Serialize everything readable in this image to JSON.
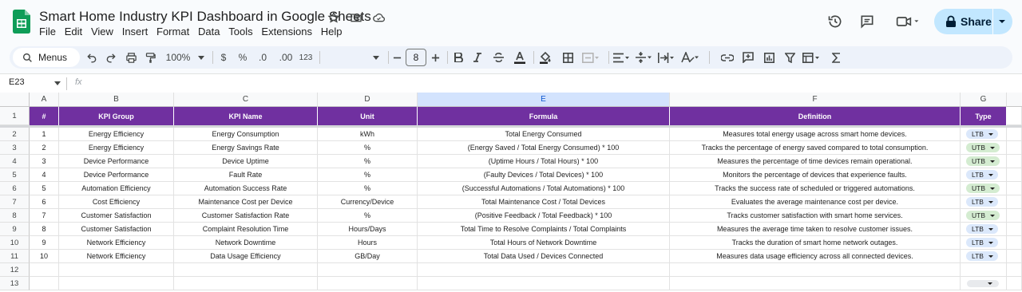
{
  "app": {
    "doc_title": "Smart Home Industry KPI Dashboard in Google Sheets",
    "menu": [
      "File",
      "Edit",
      "View",
      "Insert",
      "Format",
      "Data",
      "Tools",
      "Extensions",
      "Help"
    ],
    "share_label": "Share",
    "icons": [
      "sheets-logo",
      "star-icon",
      "move-to-folder-icon",
      "cloud-saved-icon",
      "history-icon",
      "comments-icon",
      "meet-icon"
    ]
  },
  "toolbar": {
    "search_label": "Menus",
    "zoom": "100%",
    "currency": "$",
    "percent": "%",
    "dec_decrease": ".0",
    "dec_increase": ".00",
    "number_format": "123",
    "font_size": "8"
  },
  "formula_bar": {
    "name_box": "E23",
    "fx": "fx",
    "content": ""
  },
  "sheet": {
    "columns": [
      "A",
      "B",
      "C",
      "D",
      "E",
      "F",
      "G"
    ],
    "selected_column": "E",
    "row_numbers": [
      "1",
      "2",
      "3",
      "4",
      "5",
      "6",
      "7",
      "8",
      "9",
      "10",
      "11",
      "12",
      "13"
    ],
    "header": [
      "#",
      "KPI Group",
      "KPI Name",
      "Unit",
      "Formula",
      "Definition",
      "Type"
    ],
    "header_color": "#7030a0",
    "ltb_color": "#dbe8fb",
    "utb_color": "#d4ecd1",
    "rows": [
      [
        "1",
        "Energy Efficiency",
        "Energy Consumption",
        "kWh",
        "Total Energy Consumed",
        "Measures total energy usage across smart home devices.",
        "LTB"
      ],
      [
        "2",
        "Energy Efficiency",
        "Energy Savings Rate",
        "%",
        "(Energy Saved / Total Energy Consumed) * 100",
        "Tracks the percentage of energy saved compared to total consumption.",
        "UTB"
      ],
      [
        "3",
        "Device Performance",
        "Device Uptime",
        "%",
        "(Uptime Hours / Total Hours) * 100",
        "Measures the percentage of time devices remain operational.",
        "UTB"
      ],
      [
        "4",
        "Device Performance",
        "Fault Rate",
        "%",
        "(Faulty Devices / Total Devices) * 100",
        "Monitors the percentage of devices that experience faults.",
        "LTB"
      ],
      [
        "5",
        "Automation Efficiency",
        "Automation Success Rate",
        "%",
        "(Successful Automations / Total Automations) * 100",
        "Tracks the success rate of scheduled or triggered automations.",
        "UTB"
      ],
      [
        "6",
        "Cost Efficiency",
        "Maintenance Cost per Device",
        "Currency/Device",
        "Total Maintenance Cost / Total Devices",
        "Evaluates the average maintenance cost per device.",
        "LTB"
      ],
      [
        "7",
        "Customer Satisfaction",
        "Customer Satisfaction Rate",
        "%",
        "(Positive Feedback / Total Feedback) * 100",
        "Tracks customer satisfaction with smart home services.",
        "UTB"
      ],
      [
        "8",
        "Customer Satisfaction",
        "Complaint Resolution Time",
        "Hours/Days",
        "Total Time to Resolve Complaints / Total Complaints",
        "Measures the average time taken to resolve customer issues.",
        "LTB"
      ],
      [
        "9",
        "Network Efficiency",
        "Network Downtime",
        "Hours",
        "Total Hours of Network Downtime",
        "Tracks the duration of smart home network outages.",
        "LTB"
      ],
      [
        "10",
        "Network Efficiency",
        "Data Usage Efficiency",
        "GB/Day",
        "Total Data Used / Devices Connected",
        "Measures data usage efficiency across all connected devices.",
        "LTB"
      ]
    ]
  }
}
